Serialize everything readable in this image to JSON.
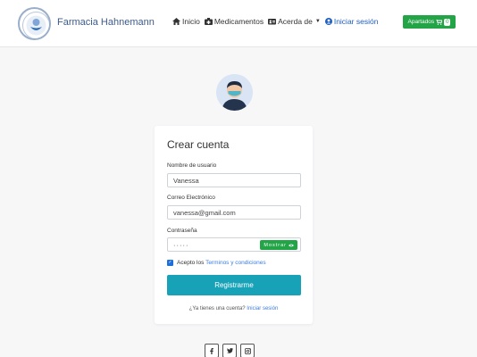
{
  "brand": {
    "name": "Farmacia Hahnemann"
  },
  "nav": {
    "items": [
      {
        "label": "Inicio",
        "icon": "home-icon"
      },
      {
        "label": "Medicamentos",
        "icon": "pills-icon"
      },
      {
        "label": "Acerda de",
        "icon": "id-card-icon"
      },
      {
        "label": "Iniciar sesión",
        "icon": "user-circle-icon"
      }
    ],
    "apartados": {
      "label": "Apartados",
      "count": "0"
    }
  },
  "form": {
    "title": "Crear cuenta",
    "username": {
      "label": "Nombre de usuario",
      "value": "Vanessa"
    },
    "email": {
      "label": "Correo Electrónico",
      "value": "vanessa@gmail.com"
    },
    "password": {
      "label": "Contraseña",
      "value": "·····",
      "show_label": "Mostrar"
    },
    "terms": {
      "prefix": "Acepto los",
      "link": "Terminos y condiciones"
    },
    "submit_label": "Registrarme",
    "footer": {
      "prefix": "¿Ya tienes una cuenta?",
      "link": "Iniciar sesión"
    }
  },
  "colors": {
    "accent": "#17a2b8",
    "green": "#22a447",
    "link": "#3c7de0",
    "brand": "#3d5a8c"
  }
}
